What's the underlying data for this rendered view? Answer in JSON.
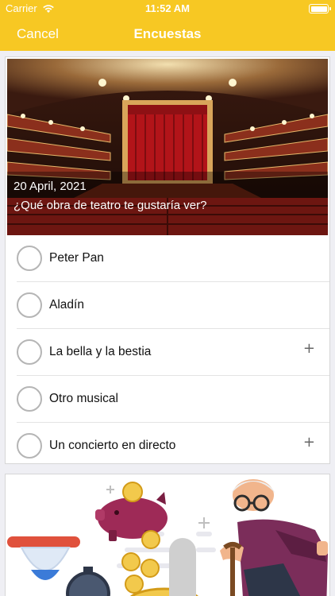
{
  "status_bar": {
    "carrier": "Carrier",
    "time": "11:52 AM"
  },
  "nav": {
    "cancel_label": "Cancel",
    "title": "Encuestas"
  },
  "poll": {
    "date": "20 April, 2021",
    "question": "¿Qué obra de teatro te gustaría ver?",
    "options": [
      {
        "label": "Peter Pan",
        "expandable": false
      },
      {
        "label": "Aladín",
        "expandable": false
      },
      {
        "label": "La bella y la bestia",
        "expandable": true
      },
      {
        "label": "Otro musical",
        "expandable": false
      },
      {
        "label": "Un concierto en directo",
        "expandable": true
      }
    ],
    "plus_symbol": "+"
  },
  "colors": {
    "accent": "#f7c823",
    "background": "#efeff4",
    "curtain": "#c4161c"
  },
  "icons": [
    "wifi-icon",
    "battery-icon",
    "radio-circle-icon",
    "plus-icon",
    "piggy-bank-icon",
    "coin-icon",
    "hourglass-icon",
    "stopwatch-icon"
  ]
}
